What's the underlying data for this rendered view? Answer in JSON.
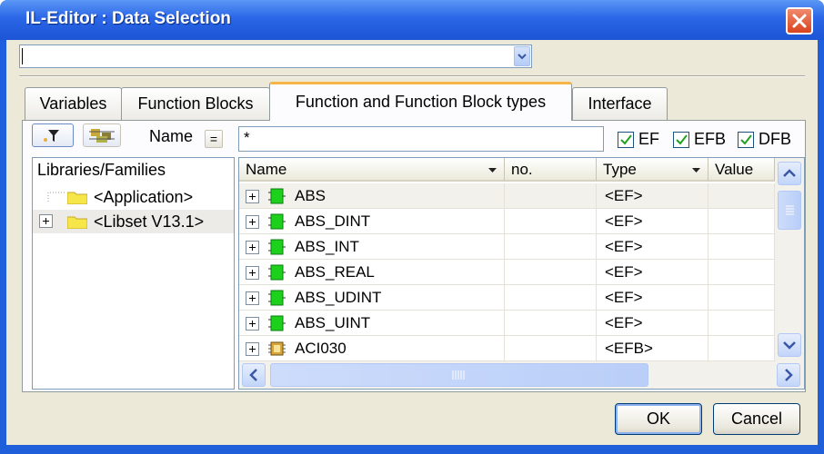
{
  "window": {
    "title": "IL-Editor : Data Selection"
  },
  "combo": {
    "value": ""
  },
  "tabs": [
    {
      "label": "Variables"
    },
    {
      "label": "Function Blocks"
    },
    {
      "label": "Function and Function Block types"
    },
    {
      "label": "Interface"
    }
  ],
  "filter": {
    "name_label": "Name",
    "equals_label": "=",
    "name_value": "*",
    "checkboxes": [
      {
        "label": "EF",
        "checked": true
      },
      {
        "label": "EFB",
        "checked": true
      },
      {
        "label": "DFB",
        "checked": true
      }
    ]
  },
  "tree": {
    "header": "Libraries/Families",
    "items": [
      {
        "label": "<Application>"
      },
      {
        "label": "<Libset V13.1>"
      }
    ]
  },
  "grid": {
    "columns": [
      "Name",
      "no.",
      "Type",
      "Value"
    ],
    "rows": [
      {
        "name": "ABS",
        "no": "",
        "type": "<EF>",
        "value": "",
        "icon": "green-function-icon"
      },
      {
        "name": "ABS_DINT",
        "no": "",
        "type": "<EF>",
        "value": "",
        "icon": "green-function-icon"
      },
      {
        "name": "ABS_INT",
        "no": "",
        "type": "<EF>",
        "value": "",
        "icon": "green-function-icon"
      },
      {
        "name": "ABS_REAL",
        "no": "",
        "type": "<EF>",
        "value": "",
        "icon": "green-function-icon"
      },
      {
        "name": "ABS_UDINT",
        "no": "",
        "type": "<EF>",
        "value": "",
        "icon": "green-function-icon"
      },
      {
        "name": "ABS_UINT",
        "no": "",
        "type": "<EF>",
        "value": "",
        "icon": "green-function-icon"
      },
      {
        "name": "ACI030",
        "no": "",
        "type": "<EFB>",
        "value": "",
        "icon": "chip-block-icon"
      }
    ]
  },
  "buttons": {
    "ok": "OK",
    "cancel": "Cancel"
  },
  "colors": {
    "title_bar": "#2a66e6",
    "dialog_bg": "#ece9d8",
    "active_tab_accent": "#f7b447",
    "function_icon": "#1bd11b"
  }
}
